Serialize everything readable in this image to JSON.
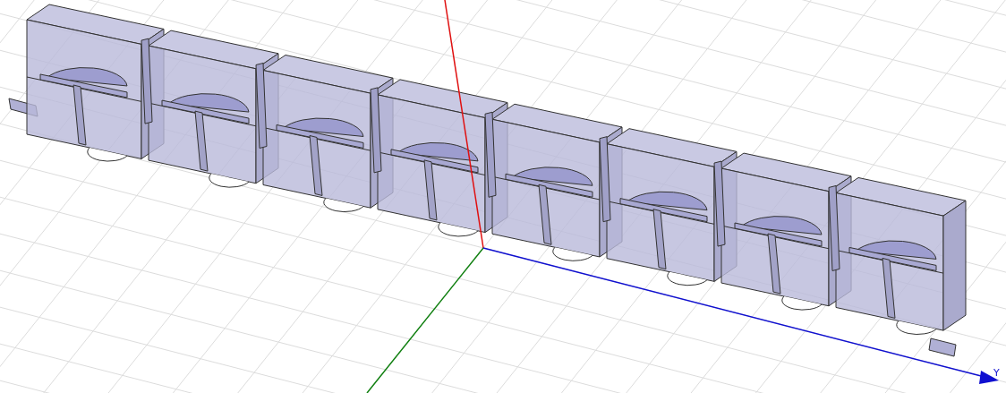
{
  "viewport": {
    "axis_label": "Y"
  }
}
